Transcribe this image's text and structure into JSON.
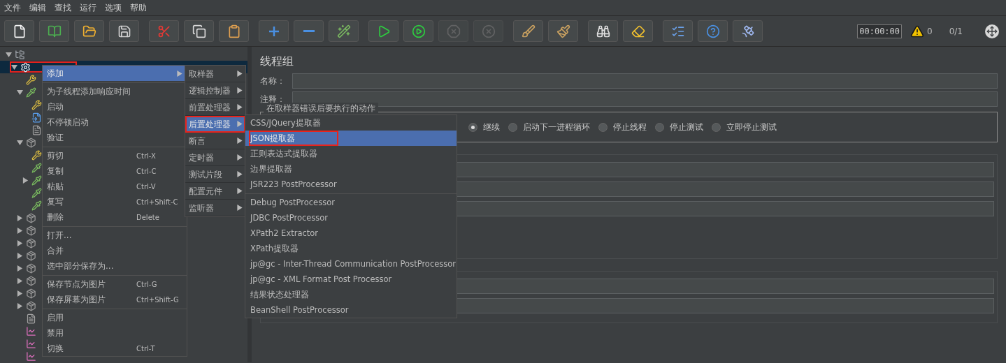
{
  "menubar": [
    "文件",
    "编辑",
    "查找",
    "运行",
    "选项",
    "帮助"
  ],
  "toolbar": [
    [
      {
        "kind": "new",
        "disabled": false
      },
      {
        "kind": "templates",
        "disabled": false
      },
      {
        "kind": "open",
        "disabled": false
      },
      {
        "kind": "save",
        "disabled": false
      }
    ],
    [
      {
        "kind": "cut",
        "disabled": false
      },
      {
        "kind": "copy",
        "disabled": false
      },
      {
        "kind": "paste",
        "disabled": false
      }
    ],
    [
      {
        "kind": "expand",
        "disabled": false
      },
      {
        "kind": "collapse",
        "disabled": false
      },
      {
        "kind": "toggle",
        "disabled": false
      }
    ],
    [
      {
        "kind": "start",
        "disabled": false
      },
      {
        "kind": "start-no-pause",
        "disabled": false
      },
      {
        "kind": "stop",
        "disabled": true
      },
      {
        "kind": "shutdown",
        "disabled": true
      }
    ],
    [
      {
        "kind": "clear",
        "disabled": false
      },
      {
        "kind": "clear-all",
        "disabled": false
      }
    ],
    [
      {
        "kind": "search",
        "disabled": false
      },
      {
        "kind": "reset-search",
        "disabled": false
      }
    ],
    [
      {
        "kind": "functions",
        "disabled": false
      },
      {
        "kind": "help",
        "disabled": false
      },
      {
        "kind": "remote",
        "disabled": false
      }
    ]
  ],
  "status": {
    "timer": "00:00:00",
    "warnings": "0",
    "threads": "0/1"
  },
  "tree": [
    {
      "kind": "plan",
      "expanded": true,
      "selected": false,
      "highlighted": false,
      "children": [
        {
          "kind": "gear",
          "expanded": true,
          "selected": true,
          "highlighted": true,
          "children": [
            {
              "kind": "tools",
              "selected": false,
              "highlighted": false
            },
            {
              "kind": "pipette",
              "expanded": true,
              "selected": false,
              "highlighted": false,
              "children": [
                {
                  "kind": "tools",
                  "selected": false,
                  "highlighted": false
                },
                {
                  "kind": "doc",
                  "selected": false,
                  "highlighted": false
                },
                {
                  "kind": "page",
                  "selected": false,
                  "highlighted": false
                }
              ]
            },
            {
              "kind": "box",
              "expanded": true,
              "selected": false,
              "highlighted": false,
              "children": [
                {
                  "kind": "tools",
                  "selected": false,
                  "highlighted": false
                },
                {
                  "kind": "pipette",
                  "selected": false,
                  "highlighted": false
                },
                {
                  "kind": "pipette",
                  "expanded": false,
                  "selected": false,
                  "highlighted": false
                },
                {
                  "kind": "pipette",
                  "selected": false,
                  "highlighted": false
                },
                {
                  "kind": "pipette",
                  "selected": false,
                  "highlighted": false
                }
              ]
            },
            {
              "kind": "box",
              "expanded": false,
              "selected": false,
              "highlighted": false
            },
            {
              "kind": "box",
              "expanded": false,
              "selected": false,
              "highlighted": false
            },
            {
              "kind": "box",
              "expanded": false,
              "selected": false,
              "highlighted": false
            },
            {
              "kind": "box",
              "expanded": false,
              "selected": false,
              "highlighted": false
            },
            {
              "kind": "box",
              "expanded": false,
              "selected": false,
              "highlighted": false
            },
            {
              "kind": "box",
              "expanded": false,
              "selected": false,
              "highlighted": false
            },
            {
              "kind": "box",
              "expanded": false,
              "selected": false,
              "highlighted": false
            },
            {
              "kind": "box",
              "expanded": false,
              "selected": false,
              "highlighted": false
            },
            {
              "kind": "page",
              "selected": false,
              "highlighted": false
            },
            {
              "kind": "chart",
              "selected": false,
              "highlighted": false
            },
            {
              "kind": "chart",
              "selected": false,
              "highlighted": false
            },
            {
              "kind": "chart",
              "selected": false,
              "highlighted": false
            }
          ]
        }
      ]
    }
  ],
  "panel": {
    "title": "线程组",
    "name_label": "名称：",
    "comment_label": "注释：",
    "error_group": "在取样器错误后要执行的动作",
    "options": [
      {
        "label": "继续",
        "selected": true
      },
      {
        "label": "启动下一进程循环",
        "selected": false
      },
      {
        "label": "停止线程",
        "selected": false
      },
      {
        "label": "停止测试",
        "selected": false
      },
      {
        "label": "立即停止测试",
        "selected": false
      }
    ]
  },
  "context_menu": [
    {
      "kind": "submenu",
      "label": "添加",
      "selected": true
    },
    {
      "kind": "separator"
    },
    {
      "kind": "item",
      "label": "为子线程添加响应时间",
      "selected": false
    },
    {
      "kind": "item",
      "label": "启动",
      "selected": false
    },
    {
      "kind": "item",
      "label": "不停顿启动",
      "selected": false
    },
    {
      "kind": "item",
      "label": "验证",
      "selected": false
    },
    {
      "kind": "separator"
    },
    {
      "kind": "item",
      "label": "剪切",
      "shortcut": "Ctrl-X",
      "selected": false
    },
    {
      "kind": "item",
      "label": "复制",
      "shortcut": "Ctrl-C",
      "selected": false
    },
    {
      "kind": "item",
      "label": "粘贴",
      "shortcut": "Ctrl-V",
      "selected": false
    },
    {
      "kind": "item",
      "label": "复写",
      "shortcut": "Ctrl+Shift-C",
      "selected": false
    },
    {
      "kind": "item",
      "label": "删除",
      "shortcut": "Delete",
      "selected": false
    },
    {
      "kind": "separator"
    },
    {
      "kind": "item",
      "label": "打开...",
      "selected": false
    },
    {
      "kind": "item",
      "label": "合并",
      "selected": false
    },
    {
      "kind": "item",
      "label": "选中部分保存为...",
      "selected": false
    },
    {
      "kind": "separator"
    },
    {
      "kind": "item",
      "label": "保存节点为图片",
      "shortcut": "Ctrl-G",
      "selected": false
    },
    {
      "kind": "item",
      "label": "保存屏幕为图片",
      "shortcut": "Ctrl+Shift-G",
      "selected": false
    },
    {
      "kind": "separator"
    },
    {
      "kind": "item",
      "label": "启用",
      "selected": false
    },
    {
      "kind": "item",
      "label": "禁用",
      "selected": false
    },
    {
      "kind": "item",
      "label": "切换",
      "shortcut": "Ctrl-T",
      "selected": false
    }
  ],
  "add_menu": [
    {
      "label": "取样器",
      "selected": false,
      "highlighted": false
    },
    {
      "label": "逻辑控制器",
      "selected": false,
      "highlighted": false
    },
    {
      "label": "前置处理器",
      "selected": false,
      "highlighted": false
    },
    {
      "label": "后置处理器",
      "selected": true,
      "highlighted": true
    },
    {
      "label": "断言",
      "selected": false,
      "highlighted": false
    },
    {
      "label": "定时器",
      "selected": false,
      "highlighted": false
    },
    {
      "label": "测试片段",
      "selected": false,
      "highlighted": false
    },
    {
      "label": "配置元件",
      "selected": false,
      "highlighted": false
    },
    {
      "label": "监听器",
      "selected": false,
      "highlighted": false
    }
  ],
  "postprocessor_menu": [
    {
      "kind": "item",
      "label": "CSS/JQuery提取器",
      "selected": false,
      "highlighted": false
    },
    {
      "kind": "item",
      "label": "JSON提取器",
      "selected": true,
      "highlighted": true
    },
    {
      "kind": "item",
      "label": "正则表达式提取器",
      "selected": false,
      "highlighted": false
    },
    {
      "kind": "item",
      "label": "边界提取器",
      "selected": false,
      "highlighted": false
    },
    {
      "kind": "item",
      "label": "JSR223 PostProcessor",
      "selected": false,
      "highlighted": false
    },
    {
      "kind": "separator"
    },
    {
      "kind": "item",
      "label": "Debug PostProcessor",
      "selected": false,
      "highlighted": false
    },
    {
      "kind": "item",
      "label": "JDBC PostProcessor",
      "selected": false,
      "highlighted": false
    },
    {
      "kind": "item",
      "label": "XPath2 Extractor",
      "selected": false,
      "highlighted": false
    },
    {
      "kind": "item",
      "label": "XPath提取器",
      "selected": false,
      "highlighted": false
    },
    {
      "kind": "item",
      "label": "jp@gc - Inter-Thread Communication PostProcessor",
      "selected": false,
      "highlighted": false
    },
    {
      "kind": "item",
      "label": "jp@gc - XML Format Post Processor",
      "selected": false,
      "highlighted": false
    },
    {
      "kind": "item",
      "label": "结果状态处理器",
      "selected": false,
      "highlighted": false
    },
    {
      "kind": "item",
      "label": "BeanShell PostProcessor",
      "selected": false,
      "highlighted": false
    }
  ]
}
